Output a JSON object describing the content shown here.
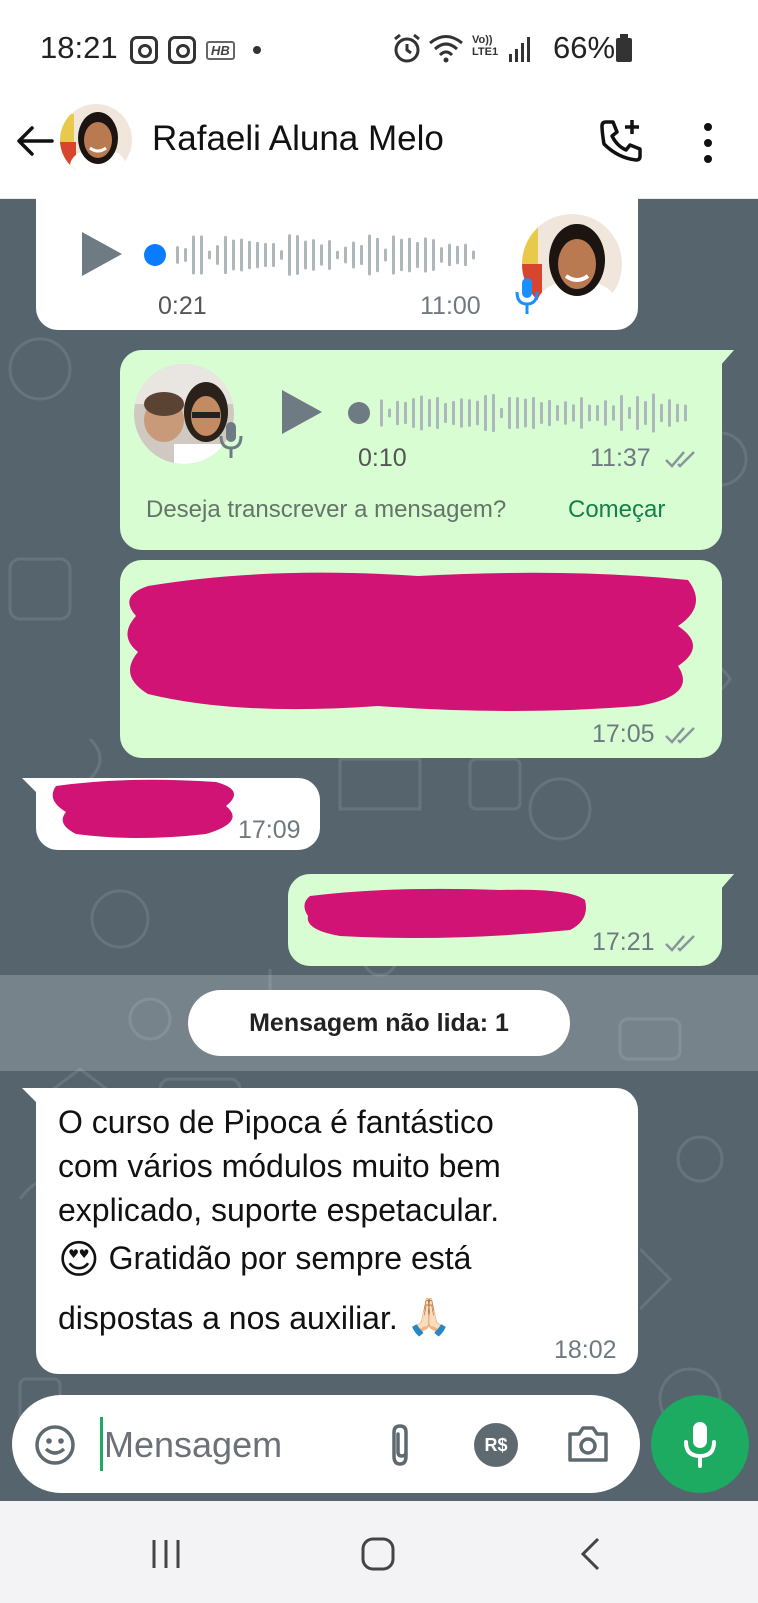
{
  "status_bar": {
    "time": "18:21",
    "notif_icons": [
      "instagram-icon",
      "instagram-icon",
      "hb-app-icon"
    ],
    "right_icons": [
      "alarm-icon",
      "wifi-icon",
      "volte-icon",
      "signal-icon"
    ],
    "volte_text": "Vo)) LTE1",
    "battery": "66%"
  },
  "header": {
    "contact_name": "Rafaeli Aluna Melo",
    "actions": [
      "add-call-icon",
      "more-options-icon"
    ]
  },
  "messages": {
    "voice_in": {
      "duration": "0:21",
      "time": "11:00"
    },
    "voice_out": {
      "duration": "0:10",
      "time": "11:37",
      "transcribe_prompt": "Deseja transcrever a mensagem?",
      "transcribe_action": "Começar"
    },
    "redacted_out_1": {
      "time": "17:05"
    },
    "redacted_in_1": {
      "time": "17:09"
    },
    "redacted_out_2": {
      "time": "17:21"
    },
    "unread_label": "Mensagem não lida: 1",
    "text_in": {
      "line1": "O curso de Pipoca  é fantástico",
      "line2": "com vários módulos muito bem",
      "line3": "explicado, suporte  espetacular.",
      "line4": "Gratidão por sempre está",
      "line5": "dispostas a nos auxiliar.",
      "emoji1": "😍",
      "emoji2": "🙏🏻",
      "time": "18:02"
    }
  },
  "composer": {
    "placeholder": "Mensagem",
    "payment_label": "R$"
  },
  "colors": {
    "chat_bg": "#56646e",
    "outgoing_bubble": "#d9fdd3",
    "incoming_bubble": "#ffffff",
    "accent_green": "#1daa61",
    "redaction": "#d01374",
    "play_icon": "#6e7b83",
    "unplayed_dot": "#0a7cff"
  }
}
